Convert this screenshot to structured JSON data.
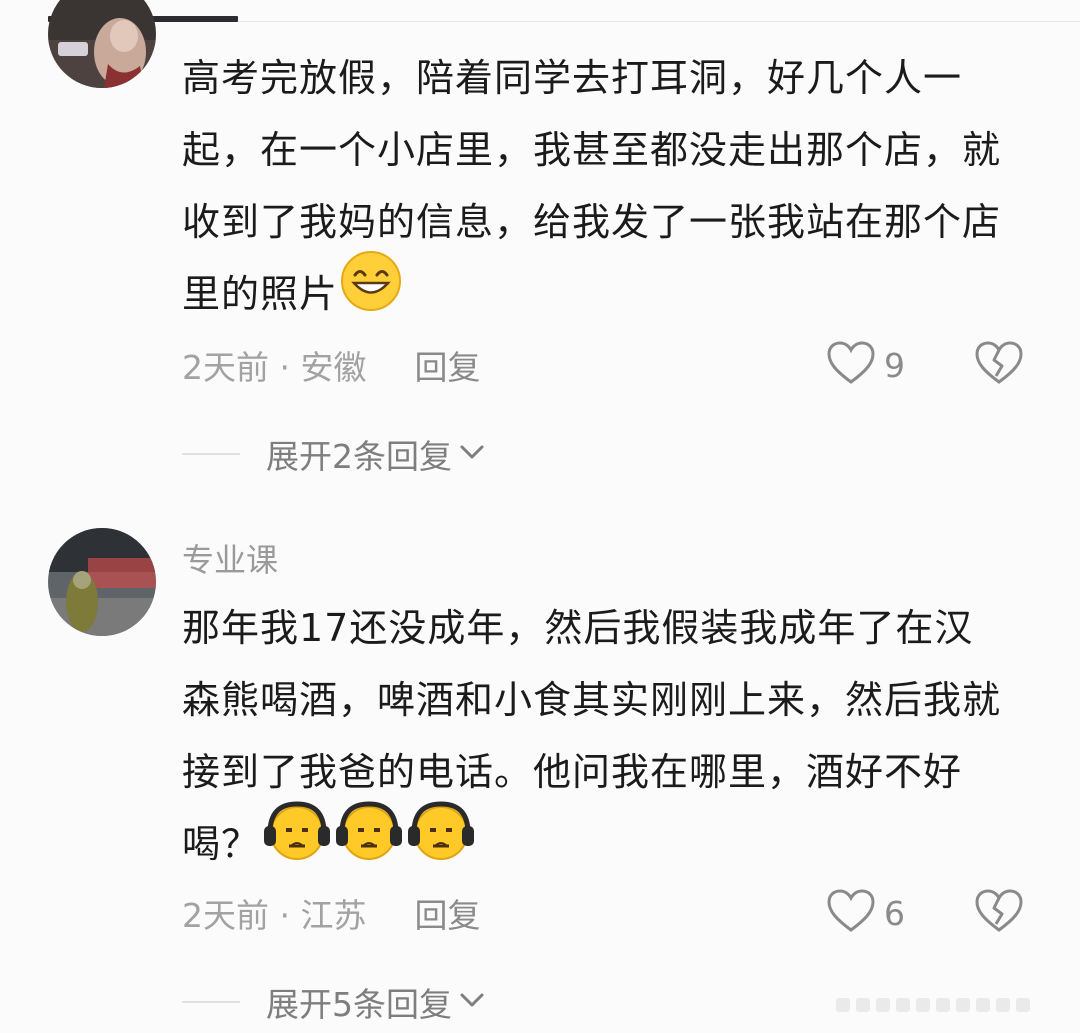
{
  "comments": [
    {
      "username": "",
      "text": "高考完放假，陪着同学去打耳洞，好几个人一起，在一个小店里，我甚至都没走出那个店，就收到了我妈的信息，给我发了一张我站在那个店里的照片",
      "emoji_names": [
        "grinning-face-icon"
      ],
      "meta": "2天前 · 安徽",
      "reply_label": "回复",
      "likes": "9",
      "expand_label": "展开2条回复"
    },
    {
      "username": "专业课",
      "text": "那年我17还没成年，然后我假装我成年了在汉森熊喝酒，啤酒和小食其实刚刚上来，然后我就接到了我爸的电话。他问我在哪里，酒好不好喝？",
      "emoji_names": [
        "headphone-sad-face-icon",
        "headphone-sad-face-icon",
        "headphone-sad-face-icon"
      ],
      "meta": "2天前 · 江苏",
      "reply_label": "回复",
      "likes": "6",
      "expand_label": "展开5条回复"
    }
  ],
  "colors": {
    "background": "#fbfbfb",
    "text": "#1b1b1b",
    "muted": "#9a9a9a",
    "icon": "#8a8a8a"
  }
}
